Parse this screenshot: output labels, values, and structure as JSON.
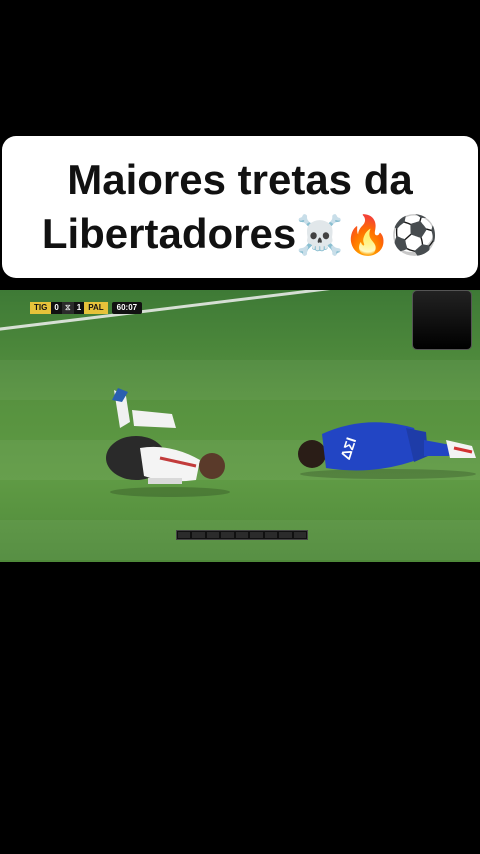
{
  "caption": {
    "line1": "Maiores tretas da",
    "line2_text": "Libertadores",
    "line2_emojis": "☠️🔥⚽"
  },
  "scorebug": {
    "home_team": "TIG",
    "home_score": "0",
    "away_score": "1",
    "away_team": "PAL",
    "clock": "60:07"
  },
  "video": {
    "progress_segments": 9
  },
  "colors": {
    "background": "#000000",
    "caption_card": "#ffffff",
    "pitch": "#5f9a44",
    "scorebug_accent": "#e6c23a"
  }
}
